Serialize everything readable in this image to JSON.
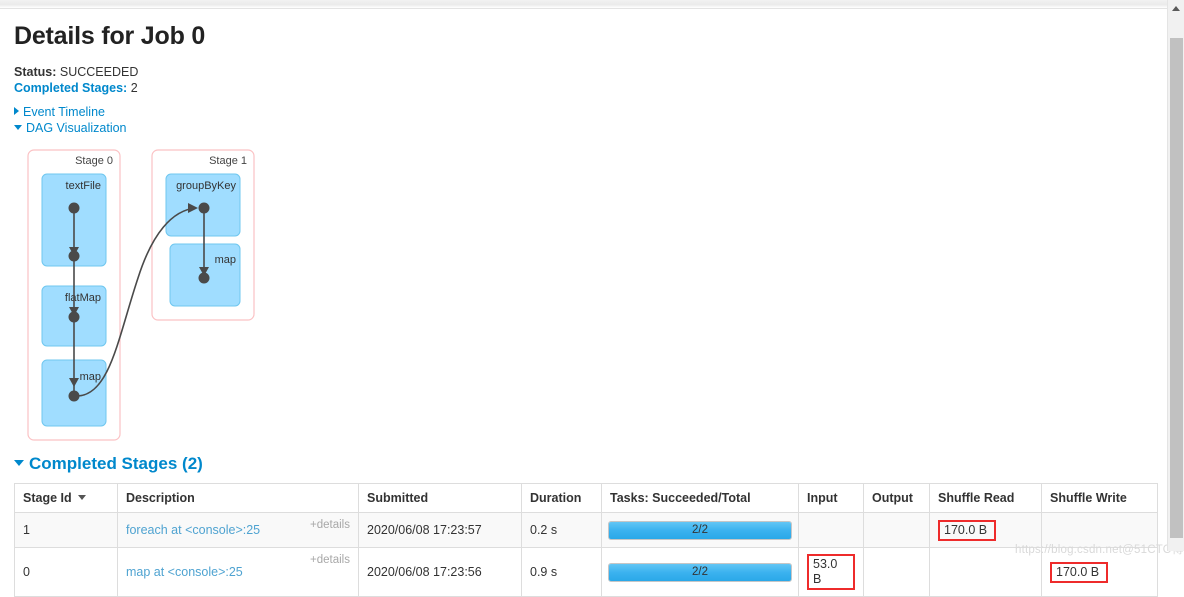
{
  "page": {
    "title": "Details for Job 0",
    "status_label": "Status:",
    "status_value": "SUCCEEDED",
    "completed_stages_label": "Completed Stages:",
    "completed_stages_value": "2",
    "event_timeline_label": "Event Timeline",
    "dag_visualization_label": "DAG Visualization",
    "completed_stages_section_label": "Completed Stages (2)",
    "watermark": "https://blog.csdn.net@51CTO博客"
  },
  "dag": {
    "stages": [
      {
        "label": "Stage 0",
        "nodes": [
          {
            "label": "textFile"
          },
          {
            "label": "flatMap"
          },
          {
            "label": "map"
          }
        ]
      },
      {
        "label": "Stage 1",
        "nodes": [
          {
            "label": "groupByKey"
          },
          {
            "label": "map"
          }
        ]
      }
    ],
    "colors": {
      "cluster_border": "#fbc2c4",
      "node_fill": "#a0ddff",
      "node_border": "#6fc7ef",
      "edge": "#4a4a4a"
    }
  },
  "table": {
    "columns": [
      {
        "key": "stage_id",
        "label": "Stage Id",
        "sorted": true
      },
      {
        "key": "description",
        "label": "Description"
      },
      {
        "key": "submitted",
        "label": "Submitted"
      },
      {
        "key": "duration",
        "label": "Duration"
      },
      {
        "key": "tasks",
        "label": "Tasks: Succeeded/Total"
      },
      {
        "key": "input",
        "label": "Input"
      },
      {
        "key": "output",
        "label": "Output"
      },
      {
        "key": "shuffle_read",
        "label": "Shuffle Read"
      },
      {
        "key": "shuffle_write",
        "label": "Shuffle Write"
      }
    ],
    "details_label": "+details",
    "rows": [
      {
        "stage_id": "1",
        "description": "foreach at <console>:25",
        "submitted": "2020/06/08 17:23:57",
        "duration": "0.2 s",
        "tasks_text": "2/2",
        "tasks_percent": 100,
        "input": "",
        "input_highlighted": false,
        "output": "",
        "shuffle_read": "170.0 B",
        "shuffle_read_highlighted": true,
        "shuffle_write": "",
        "shuffle_write_highlighted": false
      },
      {
        "stage_id": "0",
        "description": "map at <console>:25",
        "submitted": "2020/06/08 17:23:56",
        "duration": "0.9 s",
        "tasks_text": "2/2",
        "tasks_percent": 100,
        "input": "53.0 B",
        "input_highlighted": true,
        "output": "",
        "shuffle_read": "",
        "shuffle_read_highlighted": false,
        "shuffle_write": "170.0 B",
        "shuffle_write_highlighted": true
      }
    ]
  }
}
